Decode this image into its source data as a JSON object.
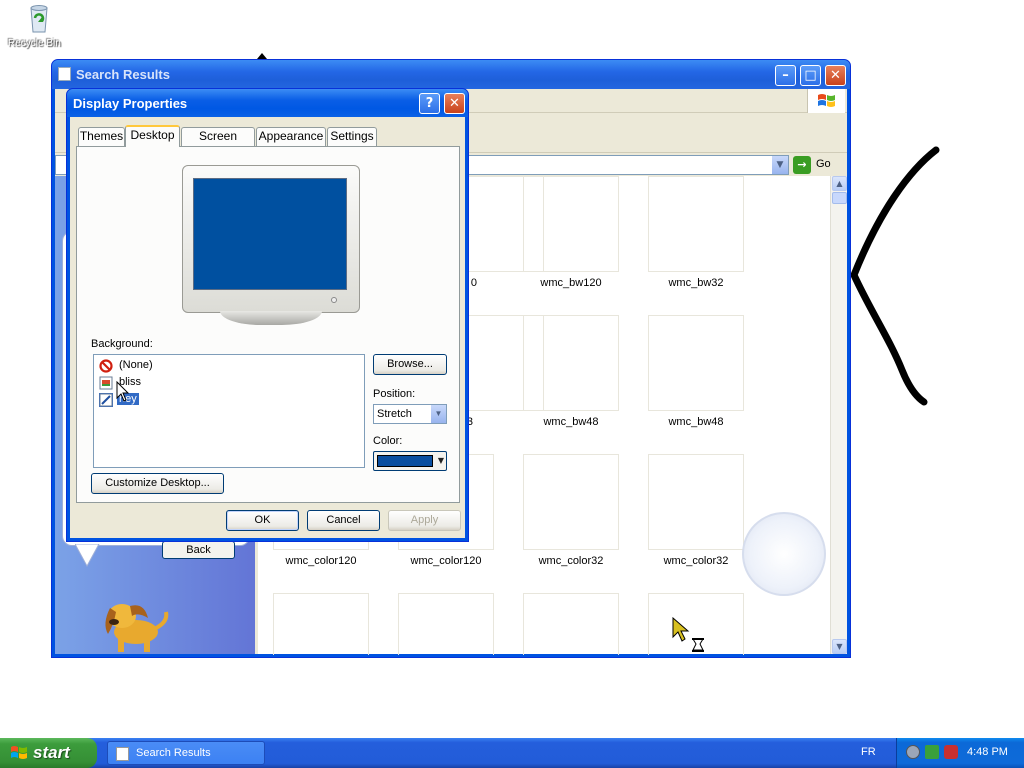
{
  "desktop": {
    "recycle_bin_label": "Recycle Bin"
  },
  "search_window": {
    "title": "Search Results",
    "go_label": "Go",
    "back_button": "Back",
    "thumbnails": [
      {
        "label": "0"
      },
      {
        "label": "wmc_bw120"
      },
      {
        "label": "wmc_bw32"
      },
      {
        "label": "3"
      },
      {
        "label": "wmc_bw48"
      },
      {
        "label": "wmc_bw48"
      },
      {
        "label": "wmc_color120"
      },
      {
        "label": "wmc_color120"
      },
      {
        "label": "wmc_color32"
      },
      {
        "label": "wmc_color32"
      }
    ]
  },
  "display_properties": {
    "title": "Display Properties",
    "tabs": [
      "Themes",
      "Desktop",
      "Screen Saver",
      "Appearance",
      "Settings"
    ],
    "active_tab": "Desktop",
    "background_label": "Background:",
    "backgrounds": [
      {
        "name": "(None)",
        "icon": "none-icon"
      },
      {
        "name": "bliss",
        "icon": "image-icon"
      },
      {
        "name": "hey",
        "icon": "drawing-icon",
        "selected": true
      }
    ],
    "browse_button": "Browse...",
    "position_label": "Position:",
    "position_value": "Stretch",
    "color_label": "Color:",
    "color_value": "#0a4fa0",
    "customize_button": "Customize Desktop...",
    "ok_button": "OK",
    "cancel_button": "Cancel",
    "apply_button": "Apply",
    "help_glyph": "?",
    "close_glyph": "✕"
  },
  "taskbar": {
    "start_label": "start",
    "task_label": "Search Results",
    "language": "FR",
    "clock": "4:48 PM"
  },
  "colors": {
    "titlebar_blue": "#0058e4",
    "desktop_preview": "#0050a0",
    "start_green": "#3c9c3c"
  }
}
